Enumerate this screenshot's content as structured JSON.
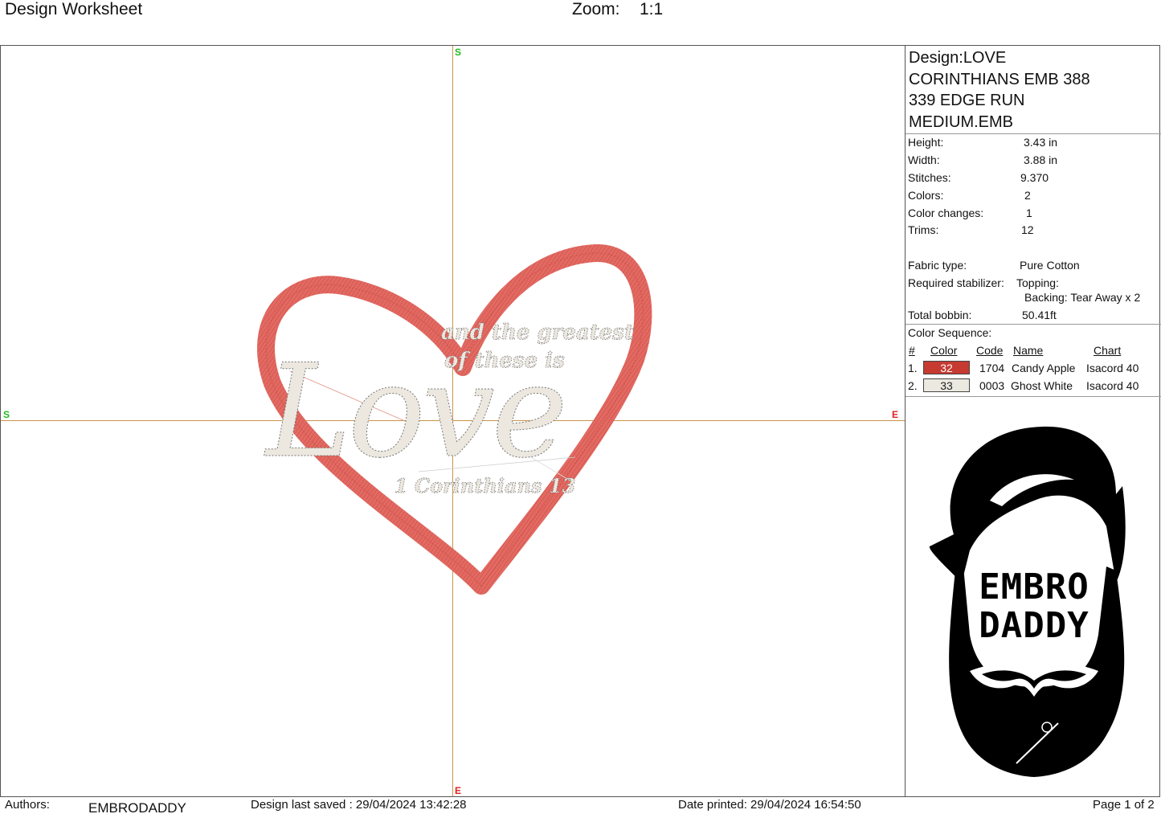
{
  "header": {
    "title": "Design Worksheet",
    "zoom_label": "Zoom:",
    "zoom_value": "1:1"
  },
  "canvas": {
    "axis_labels": {
      "top": "S",
      "left": "S",
      "right": "E",
      "bottom": "E"
    },
    "design_text": {
      "line1": "and the greatest",
      "line2": "of these is",
      "main": "Love",
      "reference": "1 Corinthians 13"
    },
    "colors": {
      "heart": "#d9574f",
      "text_fill": "#ece8df",
      "axis": "#c8944a"
    }
  },
  "panel": {
    "design_name": [
      "Design:LOVE",
      "CORINTHIANS EMB 388",
      "339 EDGE RUN",
      "MEDIUM.EMB"
    ],
    "info": [
      {
        "label": "Height:",
        "value": "3.43 in"
      },
      {
        "label": "Width:",
        "value": "3.88 in"
      },
      {
        "label": "Stitches:",
        "value": "9.370"
      },
      {
        "label": "Colors:",
        "value": "2"
      },
      {
        "label": "Color changes:",
        "value": "1"
      },
      {
        "label": "Trims:",
        "value": "12"
      }
    ],
    "fabric": {
      "label": "Fabric type:",
      "value": "Pure Cotton"
    },
    "stabilizer": {
      "label": "Required stabilizer:",
      "topping": "Topping:",
      "backing": "Backing: Tear Away x 2"
    },
    "bobbin": {
      "label": "Total bobbin:",
      "value": "50.41ft"
    },
    "color_sequence": {
      "title": "Color Sequence:",
      "headers": {
        "num": "#",
        "color": "Color",
        "code": "Code",
        "name": "Name",
        "chart": "Chart"
      },
      "rows": [
        {
          "num": "1.",
          "swatch": "32",
          "swatch_color": "#c63a32",
          "swatch_text_color": "#ffffff",
          "code": "1704",
          "name": "Candy Apple",
          "chart": "Isacord 40"
        },
        {
          "num": "2.",
          "swatch": "33",
          "swatch_color": "#ece9e1",
          "swatch_text_color": "#222222",
          "code": "0003",
          "name": "Ghost White",
          "chart": "Isacord 40"
        }
      ]
    },
    "logo": {
      "line1": "EMBRO",
      "line2": "DADDY"
    }
  },
  "footer": {
    "authors_label": "Authors:",
    "authors_value": "EMBRODADDY",
    "saved": "Design last saved : 29/04/2024 13:42:28",
    "printed": "Date printed: 29/04/2024 16:54:50",
    "page": "Page 1 of 2"
  }
}
